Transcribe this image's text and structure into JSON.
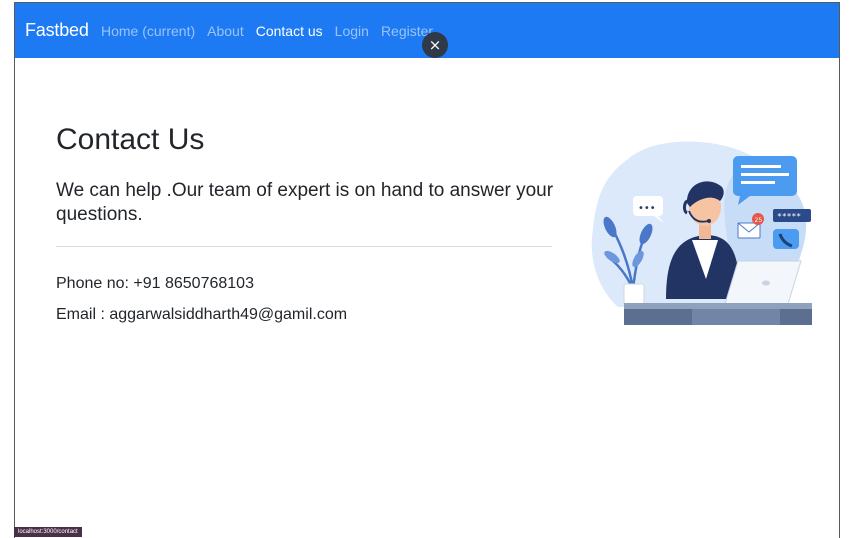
{
  "navbar": {
    "brand": "Fastbed",
    "links": [
      {
        "label": "Home (current)",
        "active": false
      },
      {
        "label": "About",
        "active": false
      },
      {
        "label": "Contact us",
        "active": true
      },
      {
        "label": "Login",
        "active": false
      },
      {
        "label": "Register",
        "active": false
      }
    ],
    "close_label": "×",
    "background": "#1d7af3"
  },
  "main": {
    "title": "Contact Us",
    "lead": "We can help .Our team of expert is on hand to answer your questions.",
    "phone": "Phone no: +91 8650768103",
    "email": "Email : aggarwalsiddharth49@gamil.com"
  },
  "illustration": {
    "icon": "customer-support-agent-illustration",
    "chat_dots": "•••",
    "password_mask": "*****",
    "notification_count": "25"
  },
  "status_bar": {
    "url": "localhost:3000/contact"
  }
}
